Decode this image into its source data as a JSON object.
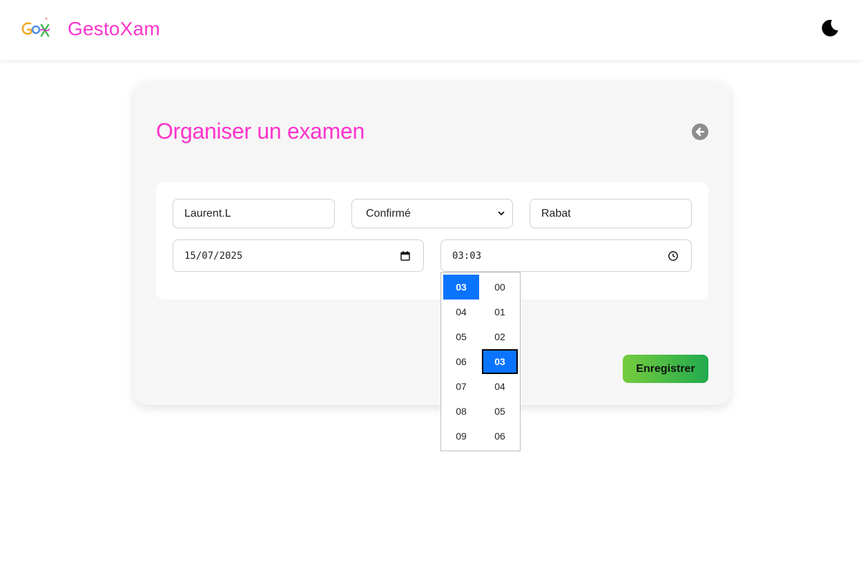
{
  "colors": {
    "brand": "#ff33cc",
    "accent": "#0b74ff",
    "button_start": "#77cc3d",
    "button_end": "#1faa4e"
  },
  "header": {
    "brand_name": "GestoXam",
    "theme_icon": "moon-icon"
  },
  "page": {
    "title": "Organiser un examen",
    "back_icon": "arrow-left-icon"
  },
  "form": {
    "user_value": "Laurent.L",
    "status_value": "Confirmé",
    "city_value": "Rabat",
    "date_value": "15/07/2025",
    "time_value": "03:03",
    "save_label": "Enregistrer"
  },
  "time_picker": {
    "hours": [
      "03",
      "04",
      "05",
      "06",
      "07",
      "08",
      "09"
    ],
    "minutes": [
      "00",
      "01",
      "02",
      "03",
      "04",
      "05",
      "06"
    ],
    "selected_hour": "03",
    "selected_minute": "03"
  }
}
